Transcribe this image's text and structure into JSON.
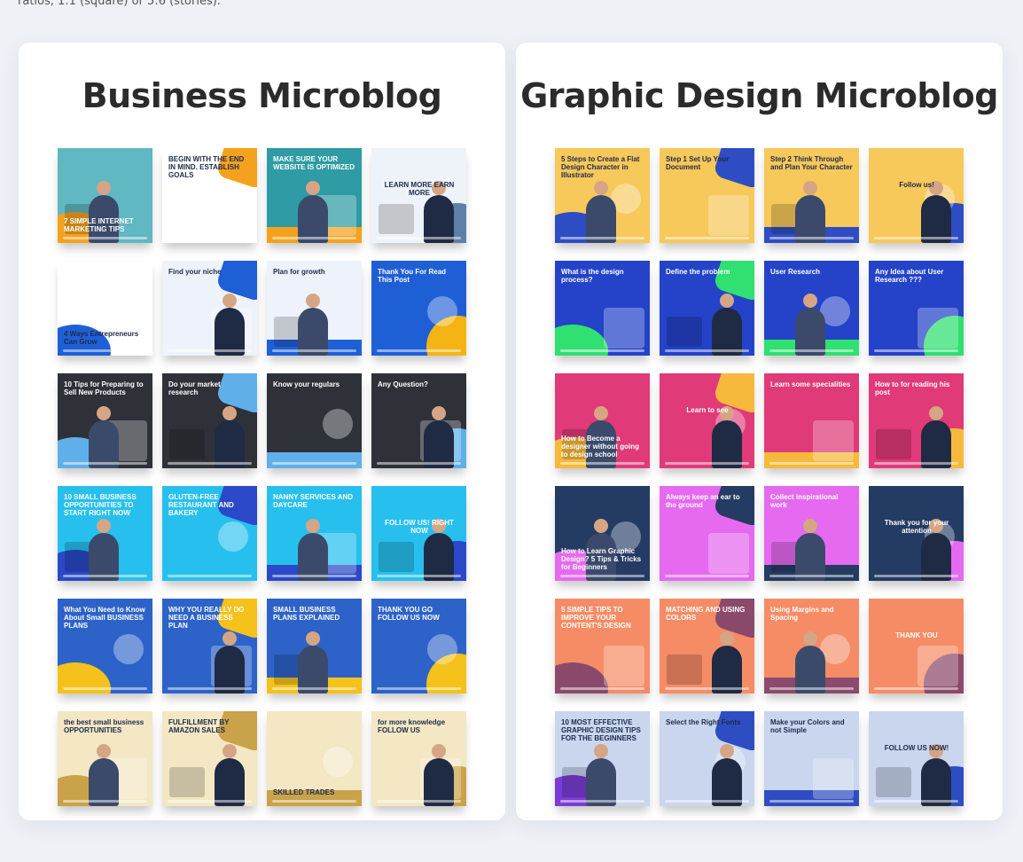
{
  "caption": "ratios, 1:1 (square) or 5:6 (stories).",
  "panels": {
    "left": {
      "title": "Business Microblog",
      "tiles": [
        {
          "text": "7 SIMPLE INTERNET MARKETING TIPS",
          "bg": "#5fb8c2",
          "accent": "#f4a21e",
          "pos": "bottom"
        },
        {
          "text": "BEGIN WITH THE END IN MIND. ESTABLISH GOALS",
          "bg": "#ffffff",
          "accent": "#f4a21e",
          "pos": "top"
        },
        {
          "text": "MAKE SURE YOUR WEBSITE IS OPTIMIZED",
          "bg": "#2f9ba4",
          "accent": "#f4a21e",
          "pos": "top"
        },
        {
          "text": "LEARN MORE EARN MORE",
          "bg": "#eef3f9",
          "accent": "#5d7fa8",
          "pos": "center"
        },
        {
          "text": "4 Ways Entrepreneurs Can Grow",
          "bg": "#ffffff",
          "accent": "#1f5fd6",
          "pos": "bottom"
        },
        {
          "text": "Find your niche",
          "bg": "#eef3fb",
          "accent": "#1f5fd6",
          "pos": "top"
        },
        {
          "text": "Plan for growth",
          "bg": "#eef3fb",
          "accent": "#1f5fd6",
          "pos": "top"
        },
        {
          "text": "Thank You For Read This Post",
          "bg": "#1f5fd6",
          "accent": "#f4b414",
          "pos": "top"
        },
        {
          "text": "10 Tips for Preparing to Sell New Products",
          "bg": "#2f3138",
          "accent": "#5fb0e8",
          "pos": "top"
        },
        {
          "text": "Do your market research",
          "bg": "#2f3138",
          "accent": "#5fb0e8",
          "pos": "top"
        },
        {
          "text": "Know your regulars",
          "bg": "#2f3138",
          "accent": "#5fb0e8",
          "pos": "top"
        },
        {
          "text": "Any Question?",
          "bg": "#2f3138",
          "accent": "#5fb0e8",
          "pos": "top"
        },
        {
          "text": "10 SMALL BUSINESS OPPORTUNITIES TO START RIGHT NOW",
          "bg": "#27c0ee",
          "accent": "#2a48c7",
          "pos": "top"
        },
        {
          "text": "GLUTEN-FREE RESTAURANT AND BAKERY",
          "bg": "#27c0ee",
          "accent": "#2a48c7",
          "pos": "top"
        },
        {
          "text": "NANNY SERVICES AND DAYCARE",
          "bg": "#27c0ee",
          "accent": "#2a48c7",
          "pos": "top"
        },
        {
          "text": "FOLLOW US! RIGHT NOW",
          "bg": "#27c0ee",
          "accent": "#2a48c7",
          "pos": "center"
        },
        {
          "text": "What You Need to Know About Small BUSINESS PLANS",
          "bg": "#2d63c8",
          "accent": "#f4c21b",
          "pos": "top"
        },
        {
          "text": "WHY YOU REALLY DO NEED A BUSINESS PLAN",
          "bg": "#2d63c8",
          "accent": "#f4c21b",
          "pos": "top"
        },
        {
          "text": "SMALL BUSINESS PLANS EXPLAINED",
          "bg": "#2d63c8",
          "accent": "#f4c21b",
          "pos": "top"
        },
        {
          "text": "THANK YOU GO FOLLOW US NOW",
          "bg": "#2d63c8",
          "accent": "#f4c21b",
          "pos": "top"
        },
        {
          "text": "the best small business OPPORTUNITIES",
          "bg": "#f3e7c4",
          "accent": "#c9a24a",
          "pos": "top"
        },
        {
          "text": "FULFILLMENT BY AMAZON SALES",
          "bg": "#f3e7c4",
          "accent": "#c9a24a",
          "pos": "top"
        },
        {
          "text": "SKILLED TRADES",
          "bg": "#f3e7c4",
          "accent": "#c9a24a",
          "pos": "bottom"
        },
        {
          "text": "for more knowledge FOLLOW US",
          "bg": "#f3e7c4",
          "accent": "#c9a24a",
          "pos": "top"
        }
      ]
    },
    "right": {
      "title": "Graphic Design Microblog",
      "tiles": [
        {
          "text": "5 Steps to Create a Flat Design Character in Illustrator",
          "bg": "#f7c85a",
          "accent": "#2f4dc2",
          "pos": "top"
        },
        {
          "text": "Step 1 Set Up Your Document",
          "bg": "#f7c85a",
          "accent": "#2f4dc2",
          "pos": "top"
        },
        {
          "text": "Step 2 Think Through and Plan Your Character",
          "bg": "#f7c85a",
          "accent": "#2f4dc2",
          "pos": "top"
        },
        {
          "text": "Follow us!",
          "bg": "#f7c85a",
          "accent": "#2f4dc2",
          "pos": "center"
        },
        {
          "text": "What is the design process?",
          "bg": "#2443c9",
          "accent": "#30e070",
          "pos": "top"
        },
        {
          "text": "Define the problem",
          "bg": "#2443c9",
          "accent": "#30e070",
          "pos": "top"
        },
        {
          "text": "User Research",
          "bg": "#2443c9",
          "accent": "#30e070",
          "pos": "top"
        },
        {
          "text": "Any Idea about User Research ???",
          "bg": "#2443c9",
          "accent": "#30e070",
          "pos": "top"
        },
        {
          "text": "How to Become a designer without going to design school",
          "bg": "#e03a78",
          "accent": "#f6b93b",
          "pos": "bottom"
        },
        {
          "text": "Learn to see",
          "bg": "#e03a78",
          "accent": "#f6b93b",
          "pos": "center"
        },
        {
          "text": "Learn some specialities",
          "bg": "#e03a78",
          "accent": "#f6b93b",
          "pos": "top"
        },
        {
          "text": "How to for reading his post",
          "bg": "#e03a78",
          "accent": "#f6b93b",
          "pos": "top"
        },
        {
          "text": "How to Learn Graphic Design? 5 Tips & Tricks for Beginners",
          "bg": "#243b63",
          "accent": "#e56af0",
          "pos": "bottom"
        },
        {
          "text": "Always keep an ear to the ground",
          "bg": "#e56af0",
          "accent": "#243b63",
          "pos": "top"
        },
        {
          "text": "Collect inspirational work",
          "bg": "#e56af0",
          "accent": "#243b63",
          "pos": "top"
        },
        {
          "text": "Thank you for your attention",
          "bg": "#243b63",
          "accent": "#e56af0",
          "pos": "center"
        },
        {
          "text": "5 SIMPLE TIPS TO IMPROVE YOUR CONTENT'S DESIGN",
          "bg": "#f58c66",
          "accent": "#8b4a6b",
          "pos": "top"
        },
        {
          "text": "MATCHING AND USING COLORS",
          "bg": "#f58c66",
          "accent": "#8b4a6b",
          "pos": "top"
        },
        {
          "text": "Using Margins and Spacing",
          "bg": "#f58c66",
          "accent": "#8b4a6b",
          "pos": "top"
        },
        {
          "text": "THANK YOU",
          "bg": "#f58c66",
          "accent": "#8b4a6b",
          "pos": "center"
        },
        {
          "text": "10 MOST EFFECTIVE GRAPHIC DESIGN TIPS FOR THE BEGINNERS",
          "bg": "#c9d6ee",
          "accent": "#7a3cd6",
          "pos": "top"
        },
        {
          "text": "Select the Right Fonts",
          "bg": "#c9d6ee",
          "accent": "#2f4dc2",
          "pos": "top"
        },
        {
          "text": "Make your Colors and not Simple",
          "bg": "#c9d6ee",
          "accent": "#2f4dc2",
          "pos": "top"
        },
        {
          "text": "FOLLOW US NOW!",
          "bg": "#c9d6ee",
          "accent": "#2f4dc2",
          "pos": "center"
        }
      ]
    }
  }
}
